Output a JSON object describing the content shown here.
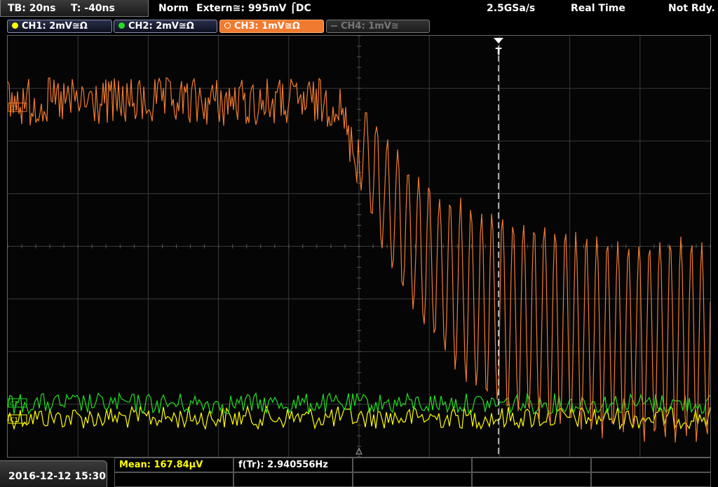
{
  "topbar": {
    "timebase": "TB: 20ns",
    "trigger_offset": "T: -40ns",
    "trigger_mode": "Norm",
    "trigger_source": "Extern≅: 995mV ⌠DC",
    "sample_rate": "2.5GSa/s",
    "acq_mode": "Real Time",
    "status": "Not Rdy."
  },
  "channels": [
    {
      "label": "CH1: 2mV≅Ω",
      "color": "#ffff00",
      "state": "on"
    },
    {
      "label": "CH2: 2mV≅Ω",
      "color": "#22dd22",
      "state": "on"
    },
    {
      "label": "CH3: 1mV≅Ω",
      "color": "#f07a30",
      "state": "active"
    },
    {
      "label": "CH4: 1mV≅",
      "color": "#888888",
      "state": "off"
    }
  ],
  "markers": {
    "ch3": "C3",
    "ch2": "C2",
    "ch1": "C1",
    "trigger": "T"
  },
  "measurements": {
    "mean": "Mean: 167.84µV",
    "frequency": "f(Tr): 2.940556Hz"
  },
  "datetime": "2016-12-12 15:30",
  "colors": {
    "ch1": "#ffff00",
    "ch2": "#22dd22",
    "ch3": "#f07a30",
    "grid": "#3a3a3a",
    "mean_text": "#ffff00"
  }
}
